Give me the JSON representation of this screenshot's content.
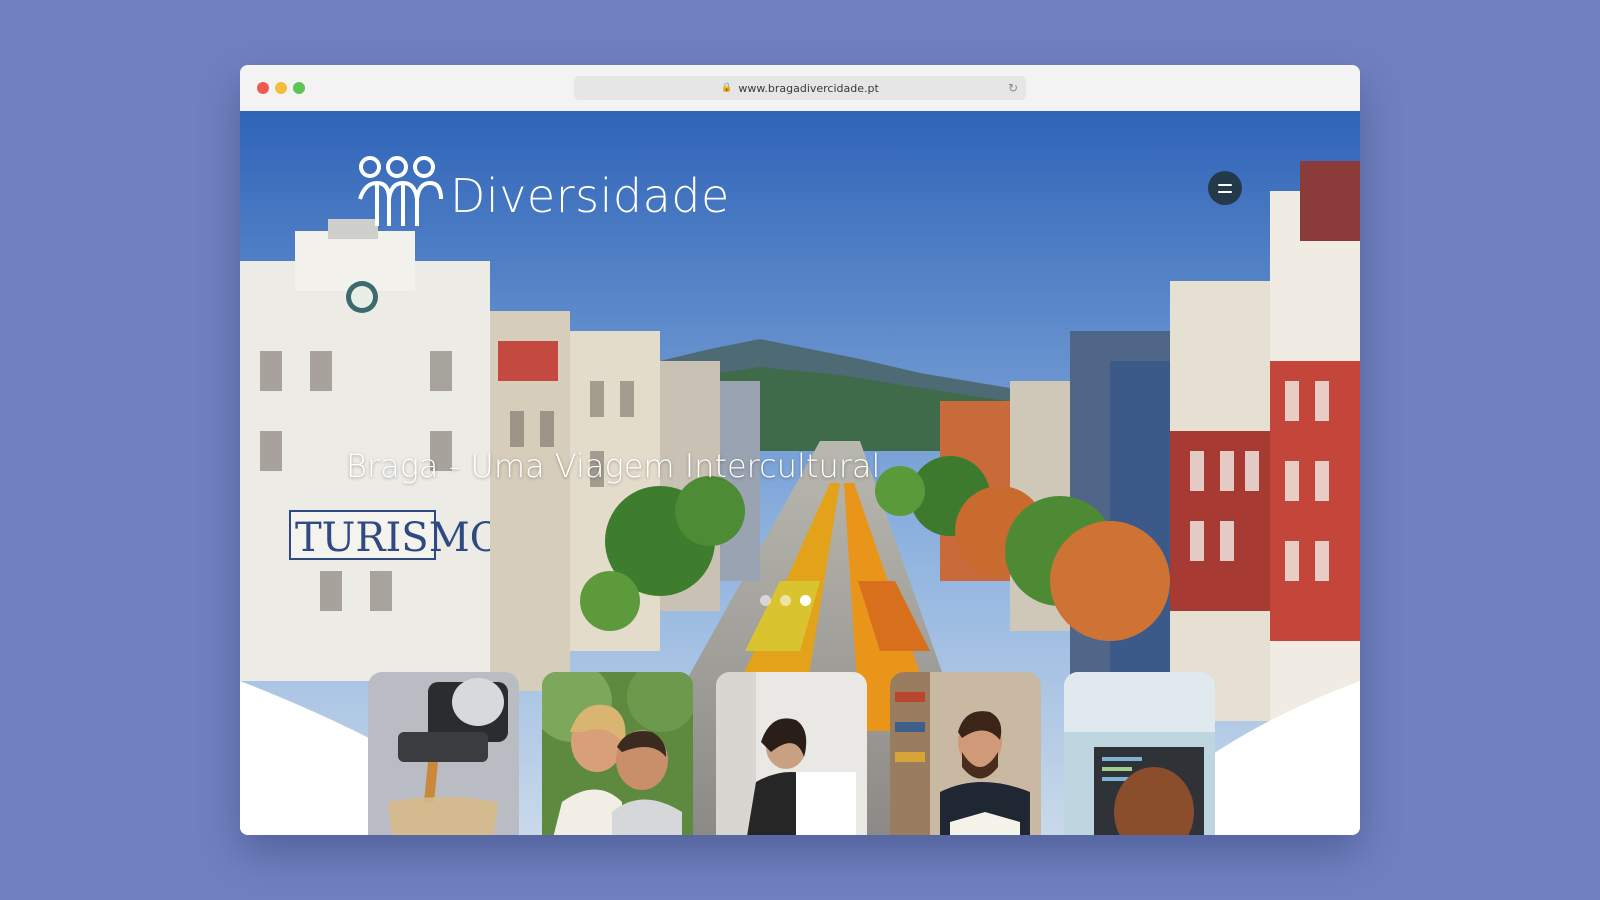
{
  "browser": {
    "url": "www.bragadivercidade.pt"
  },
  "site": {
    "logo_text": "Diversidade",
    "headline": "Braga - Uma Viagem Intercultural",
    "slider": {
      "count": 3,
      "active": 3
    }
  },
  "cards": [
    {
      "subject": "espresso-machine"
    },
    {
      "subject": "smiling-couple"
    },
    {
      "subject": "woman-working"
    },
    {
      "subject": "man-reading-book"
    },
    {
      "subject": "computer-screen"
    }
  ],
  "colors": {
    "background": "#7081c0",
    "menu_button": "#243a4a",
    "sky": "#3d73c2"
  }
}
